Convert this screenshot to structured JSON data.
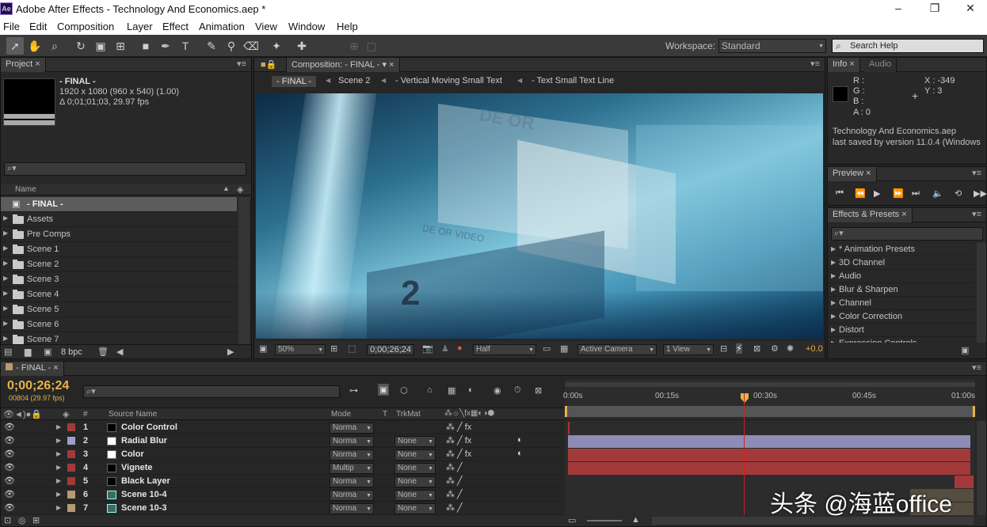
{
  "window": {
    "title": "Adobe After Effects - Technology And Economics.aep *",
    "logo_text": "Ae"
  },
  "menu": [
    "File",
    "Edit",
    "Composition",
    "Layer",
    "Effect",
    "Animation",
    "View",
    "Window",
    "Help"
  ],
  "toolbar": {
    "workspace_label": "Workspace:",
    "workspace_value": "Standard",
    "search_help_placeholder": "Search Help"
  },
  "project": {
    "tab": "Project",
    "comp_name": "- FINAL -",
    "comp_dims": "1920 x 1080  (960 x 540) (1.00)",
    "comp_duration": "Δ 0;01;01;03, 29.97 fps",
    "name_header": "Name",
    "items": [
      {
        "name": "- FINAL -",
        "type": "comp"
      },
      {
        "name": "Assets",
        "type": "folder"
      },
      {
        "name": "Pre Comps",
        "type": "folder"
      },
      {
        "name": "Scene 1",
        "type": "folder"
      },
      {
        "name": "Scene 2",
        "type": "folder"
      },
      {
        "name": "Scene 3",
        "type": "folder"
      },
      {
        "name": "Scene 4",
        "type": "folder"
      },
      {
        "name": "Scene 5",
        "type": "folder"
      },
      {
        "name": "Scene 6",
        "type": "folder"
      },
      {
        "name": "Scene 7",
        "type": "folder"
      }
    ],
    "bpc": "8 bpc"
  },
  "composition": {
    "tab": "Composition: - FINAL -",
    "breadcrumbs": [
      "- FINAL -",
      "Scene 2",
      "- Vertical Moving Small Text",
      "- Text Small Text Line"
    ],
    "zoom": "50%",
    "timecode": "0;00;26;24",
    "resolution": "Half",
    "camera": "Active Camera",
    "views": "1 View",
    "exposure": "+0.0",
    "viewer_text": {
      "big_number": "2",
      "top_text": "DE OR",
      "mid_text": "DE OR VIDEO"
    }
  },
  "info": {
    "tabs": [
      "Info",
      "Audio"
    ],
    "r": "R :",
    "g": "G :",
    "b": "B :",
    "a": "A : 0",
    "x": "X : -349",
    "y": "Y : 3",
    "file": "Technology And Economics.aep",
    "saved": "last saved by version 11.0.4 (Windows"
  },
  "preview": {
    "tab": "Preview"
  },
  "effects": {
    "tab": "Effects & Presets",
    "items": [
      "* Animation Presets",
      "3D Channel",
      "Audio",
      "Blur & Sharpen",
      "Channel",
      "Color Correction",
      "Distort",
      "Expression Controls"
    ]
  },
  "timeline": {
    "tab": "- FINAL -",
    "timecode": "0;00;26;24",
    "frames": "00804 (29.97 fps)",
    "columns": {
      "source": "Source Name",
      "mode": "Mode",
      "t": "T",
      "trkmat": "TrkMat",
      "num": "#"
    },
    "ruler": [
      "0:00s",
      "00:15s",
      "00:30s",
      "00:45s",
      "01:00s"
    ],
    "layers": [
      {
        "num": "1",
        "name": "Color Control",
        "mode": "Norma",
        "trkmat": "",
        "label": "#a33a3a",
        "thumb": "#000000"
      },
      {
        "num": "2",
        "name": "Radial Blur",
        "mode": "Norma",
        "trkmat": "None",
        "label": "#9e9ec8",
        "thumb": "#ffffff"
      },
      {
        "num": "3",
        "name": "Color",
        "mode": "Norma",
        "trkmat": "None",
        "label": "#a33a3a",
        "thumb": "#ffffff"
      },
      {
        "num": "4",
        "name": "Vignete",
        "mode": "Multip",
        "trkmat": "None",
        "label": "#a33a3a",
        "thumb": "#000000"
      },
      {
        "num": "5",
        "name": "Black Layer",
        "mode": "Norma",
        "trkmat": "None",
        "label": "#a33a3a",
        "thumb": "#000000"
      },
      {
        "num": "6",
        "name": "Scene 10-4",
        "mode": "Norma",
        "trkmat": "None",
        "label": "#b59a72",
        "thumb": "comp"
      },
      {
        "num": "7",
        "name": "Scene 10-3",
        "mode": "Norma",
        "trkmat": "None",
        "label": "#b59a72",
        "thumb": "comp"
      }
    ]
  },
  "watermark": "头条 @海蓝office"
}
